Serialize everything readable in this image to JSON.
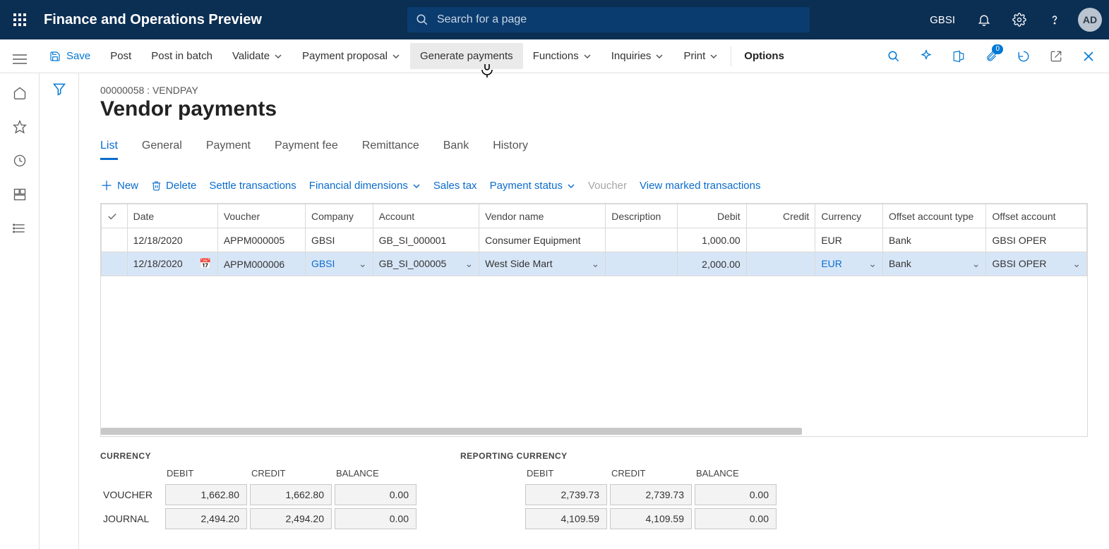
{
  "topbar": {
    "app_title": "Finance and Operations Preview",
    "search_placeholder": "Search for a page",
    "company": "GBSI",
    "avatar_initials": "AD"
  },
  "actionbar": {
    "save": "Save",
    "post": "Post",
    "post_in_batch": "Post in batch",
    "validate": "Validate",
    "payment_proposal": "Payment proposal",
    "generate_payments": "Generate payments",
    "functions": "Functions",
    "inquiries": "Inquiries",
    "print": "Print",
    "options": "Options",
    "attach_badge": "0"
  },
  "page": {
    "breadcrumb": "00000058 : VENDPAY",
    "title": "Vendor payments"
  },
  "tabs": [
    "List",
    "General",
    "Payment",
    "Payment fee",
    "Remittance",
    "Bank",
    "History"
  ],
  "subbar": {
    "new": "New",
    "delete": "Delete",
    "settle": "Settle transactions",
    "fin_dim": "Financial dimensions",
    "sales_tax": "Sales tax",
    "payment_status": "Payment status",
    "voucher": "Voucher",
    "view_marked": "View marked transactions"
  },
  "grid": {
    "headers": {
      "date": "Date",
      "voucher": "Voucher",
      "company": "Company",
      "account": "Account",
      "vendor_name": "Vendor name",
      "description": "Description",
      "debit": "Debit",
      "credit": "Credit",
      "currency": "Currency",
      "offset_type": "Offset account type",
      "offset_account": "Offset account"
    },
    "rows": [
      {
        "date": "12/18/2020",
        "voucher": "APPM000005",
        "company": "GBSI",
        "account": "GB_SI_000001",
        "vendor_name": "Consumer Equipment",
        "description": "",
        "debit": "1,000.00",
        "credit": "",
        "currency": "EUR",
        "offset_type": "Bank",
        "offset_account": "GBSI OPER"
      },
      {
        "date": "12/18/2020",
        "voucher": "APPM000006",
        "company": "GBSI",
        "account": "GB_SI_000005",
        "vendor_name": "West Side Mart",
        "description": "",
        "debit": "2,000.00",
        "credit": "",
        "currency": "EUR",
        "offset_type": "Bank",
        "offset_account": "GBSI OPER"
      }
    ]
  },
  "totals": {
    "currency": {
      "title": "CURRENCY",
      "debit_label": "DEBIT",
      "credit_label": "CREDIT",
      "balance_label": "BALANCE",
      "rows": {
        "voucher": {
          "label": "VOUCHER",
          "debit": "1,662.80",
          "credit": "1,662.80",
          "balance": "0.00"
        },
        "journal": {
          "label": "JOURNAL",
          "debit": "2,494.20",
          "credit": "2,494.20",
          "balance": "0.00"
        }
      }
    },
    "reporting": {
      "title": "REPORTING CURRENCY",
      "debit_label": "DEBIT",
      "credit_label": "CREDIT",
      "balance_label": "BALANCE",
      "rows": {
        "voucher": {
          "debit": "2,739.73",
          "credit": "2,739.73",
          "balance": "0.00"
        },
        "journal": {
          "debit": "4,109.59",
          "credit": "4,109.59",
          "balance": "0.00"
        }
      }
    }
  }
}
